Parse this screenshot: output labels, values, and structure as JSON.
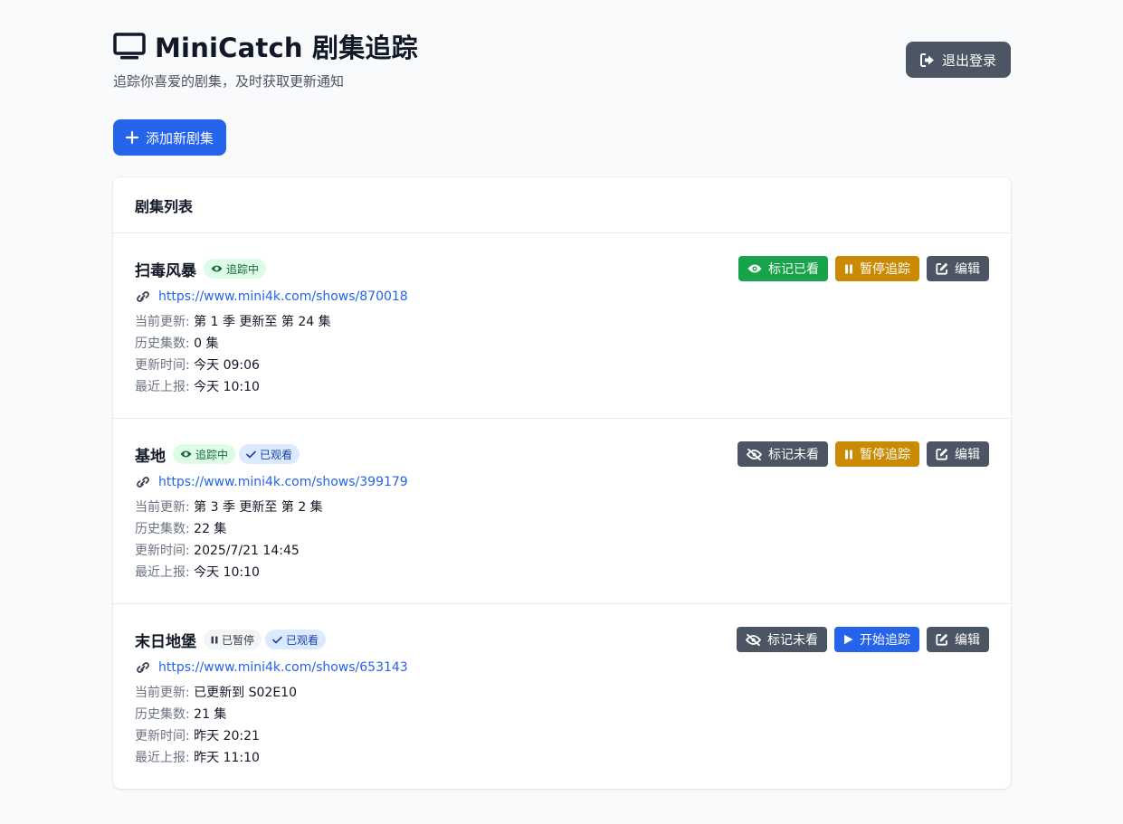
{
  "header": {
    "title": "MiniCatch 剧集追踪",
    "subtitle": "追踪你喜爱的剧集，及时获取更新通知",
    "logout_label": "退出登录",
    "add_label": "添加新剧集"
  },
  "list": {
    "title": "剧集列表",
    "labels": {
      "current": "当前更新:",
      "history": "历史集数:",
      "updated": "更新时间:",
      "reported": "最近上报:"
    },
    "shows": [
      {
        "name": "扫毒风暴",
        "status_badge": "追踪中",
        "watched_badge": "",
        "url": "https://www.mini4k.com/shows/870018",
        "current": "第 1 季 更新至 第 24 集",
        "history": "0 集",
        "updated": "今天 09:06",
        "reported": "今天 10:10",
        "watch_action": "标记已看",
        "track_action": "暂停追踪",
        "edit_action": "编辑"
      },
      {
        "name": "基地",
        "status_badge": "追踪中",
        "watched_badge": "已观看",
        "url": "https://www.mini4k.com/shows/399179",
        "current": "第 3 季 更新至 第 2 集",
        "history": "22 集",
        "updated": "2025/7/21 14:45",
        "reported": "今天 10:10",
        "watch_action": "标记未看",
        "track_action": "暂停追踪",
        "edit_action": "编辑"
      },
      {
        "name": "末日地堡",
        "status_badge": "已暂停",
        "watched_badge": "已观看",
        "url": "https://www.mini4k.com/shows/653143",
        "current": "已更新到 S02E10",
        "history": "21 集",
        "updated": "昨天 20:21",
        "reported": "昨天 11:10",
        "watch_action": "标记未看",
        "track_action": "开始追踪",
        "edit_action": "编辑"
      }
    ]
  },
  "colors": {
    "primary": "#2563eb",
    "success": "#16a34a",
    "warning": "#ca8a04",
    "neutral": "#4b5563"
  }
}
